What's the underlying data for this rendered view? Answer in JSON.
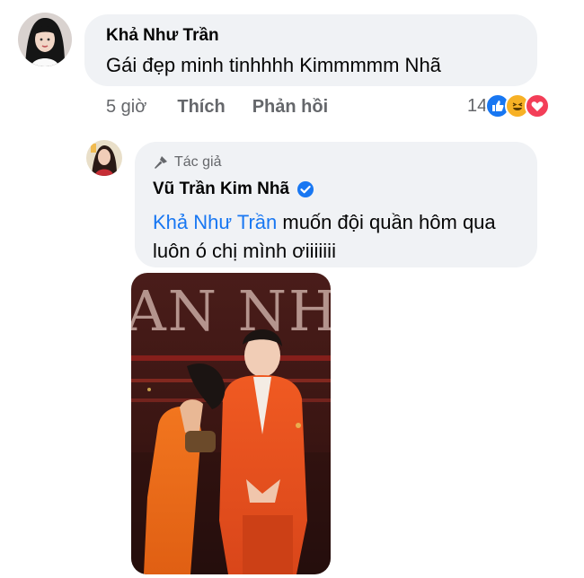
{
  "comment1": {
    "author": "Khả Như Trần",
    "text": "Gái đẹp minh tinhhhh Kimmmmm Nhã",
    "time": "5 giờ",
    "like_label": "Thích",
    "reply_label": "Phản hồi",
    "reaction_count": "14",
    "reactions": [
      "like-icon",
      "haha-icon",
      "love-icon"
    ]
  },
  "reply1": {
    "badge_label": "Tác giả",
    "author": "Vũ Trần Kim Nhã",
    "verified": true,
    "mention": "Khả Như Trần",
    "text": " muốn đội quần hôm qua luôn ó chị mình ơiiiiiii"
  },
  "photo": {
    "poster_text": "AN NH",
    "caption": "photo of two people at a red carpet event"
  },
  "colors": {
    "bubble": "#f0f2f5",
    "mention": "#1877f2",
    "muted": "#65676b",
    "like": "#1877f2",
    "love": "#f33e58",
    "haha": "#f7b125"
  }
}
